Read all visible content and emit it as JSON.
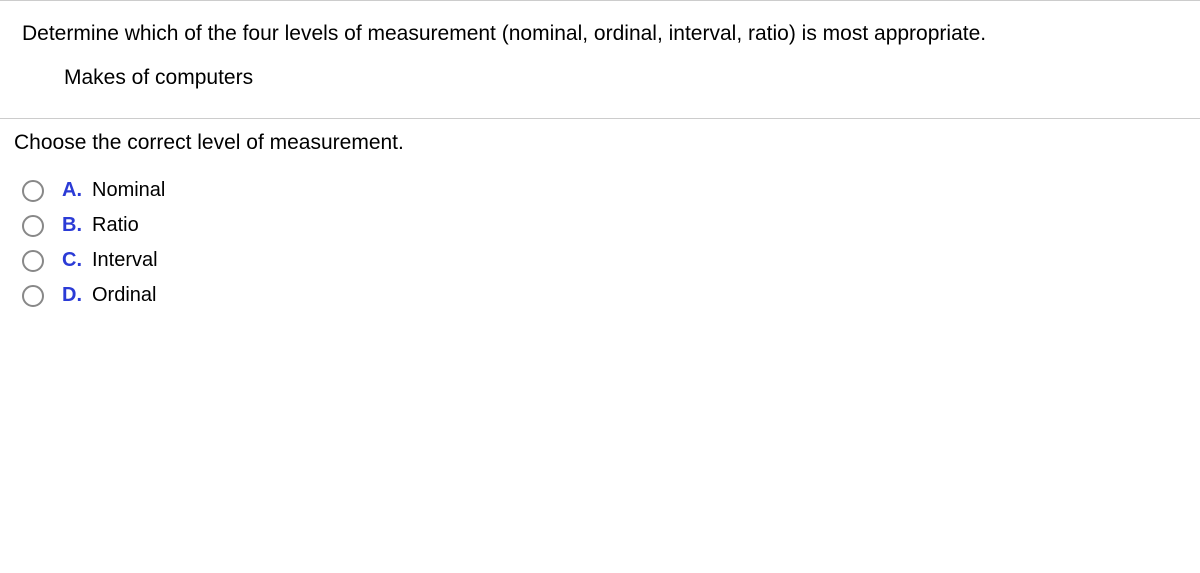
{
  "question": {
    "prompt": "Determine which of the four levels of measurement (nominal, ordinal, interval, ratio) is most appropriate.",
    "subject": "Makes of computers"
  },
  "instruction": "Choose the correct level of measurement.",
  "options": [
    {
      "letter": "A.",
      "label": "Nominal"
    },
    {
      "letter": "B.",
      "label": "Ratio"
    },
    {
      "letter": "C.",
      "label": "Interval"
    },
    {
      "letter": "D.",
      "label": "Ordinal"
    }
  ]
}
